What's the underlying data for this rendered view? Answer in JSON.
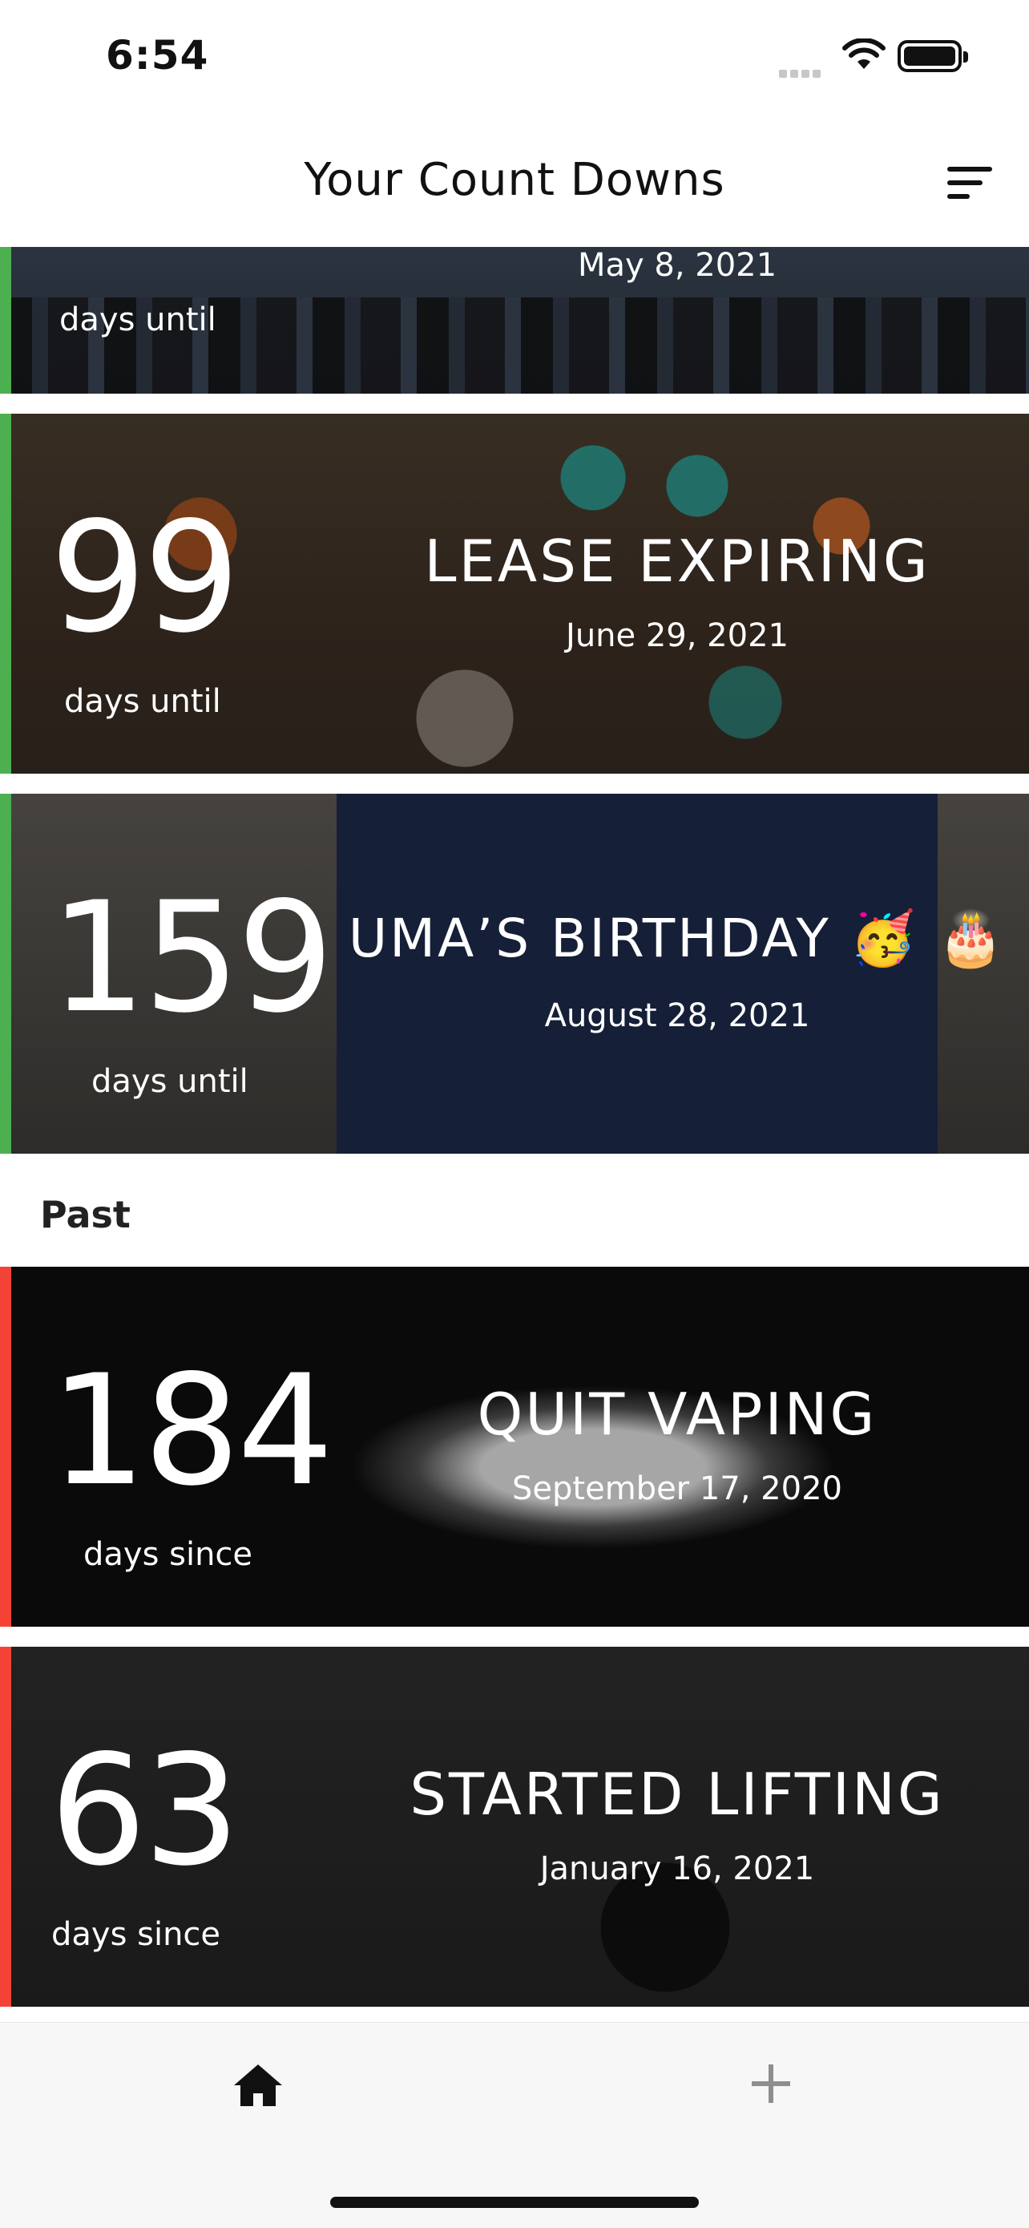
{
  "status_bar": {
    "time": "6:54"
  },
  "header": {
    "title": "Your Count Downs",
    "sort_icon": "sort-lines-icon"
  },
  "upcoming": [
    {
      "unit": "days until",
      "date": "May 8, 2021",
      "accent": "#4caf50"
    },
    {
      "count": "99",
      "unit": "days until",
      "title": "LEASE EXPIRING",
      "date": "June 29, 2021",
      "accent": "#4caf50"
    },
    {
      "count": "159",
      "unit": "days until",
      "title": "UMA’S BIRTHDAY 🥳 🎂",
      "date": "August 28, 2021",
      "accent": "#4caf50"
    }
  ],
  "past_section": {
    "title": "Past"
  },
  "past": [
    {
      "count": "184",
      "unit": "days since",
      "title": "QUIT VAPING",
      "date": "September 17, 2020",
      "accent": "#f44336"
    },
    {
      "count": "63",
      "unit": "days since",
      "title": "STARTED LIFTING",
      "date": "January 16, 2021",
      "accent": "#f44336"
    }
  ],
  "tabbar": {
    "home_icon": "home-icon",
    "add_icon": "plus-icon"
  }
}
